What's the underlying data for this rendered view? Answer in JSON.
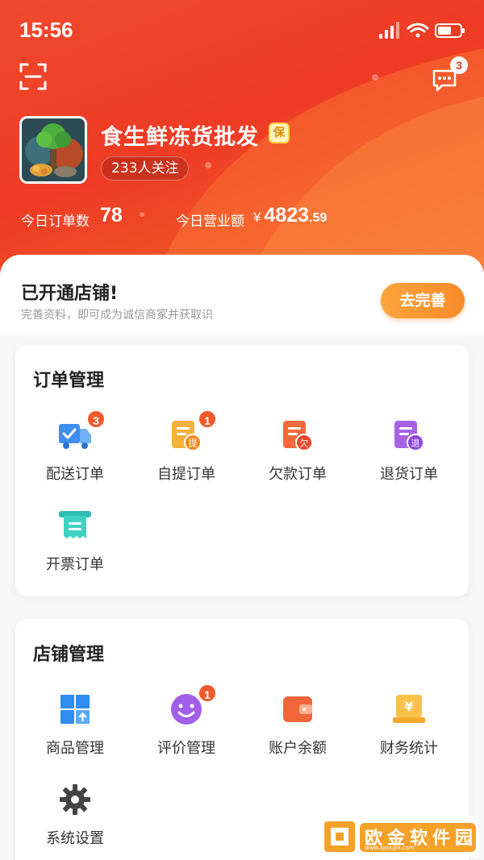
{
  "status_bar": {
    "time": "15:56"
  },
  "header": {
    "message_badge": "3",
    "shop_name": "食生鲜冻货批发",
    "shop_badge": "保",
    "followers": "233人关注",
    "stats": {
      "orders_label": "今日订单数",
      "orders_value": "78",
      "revenue_label": "今日营业额",
      "revenue_currency": "¥",
      "revenue_int": "4823",
      "revenue_dec": ".59"
    }
  },
  "promo": {
    "title": "已开通店铺!",
    "subtitle": "完善资料，即可成为诚信商家并获取识",
    "button": "去完善"
  },
  "order_management": {
    "title": "订单管理",
    "items": [
      {
        "label": "配送订单",
        "icon": "delivery-truck-icon",
        "badge": "3"
      },
      {
        "label": "自提订单",
        "icon": "pickup-order-icon",
        "badge": "1"
      },
      {
        "label": "欠款订单",
        "icon": "debt-order-icon",
        "badge": ""
      },
      {
        "label": "退货订单",
        "icon": "return-order-icon",
        "badge": ""
      },
      {
        "label": "开票订单",
        "icon": "invoice-icon",
        "badge": ""
      }
    ],
    "icon_text": {
      "pickup": "提",
      "debt": "欠",
      "return": "退"
    }
  },
  "store_management": {
    "title": "店铺管理",
    "items": [
      {
        "label": "商品管理",
        "icon": "product-grid-icon",
        "badge": ""
      },
      {
        "label": "评价管理",
        "icon": "smile-review-icon",
        "badge": "1"
      },
      {
        "label": "账户余额",
        "icon": "wallet-icon",
        "badge": ""
      },
      {
        "label": "财务统计",
        "icon": "finance-icon",
        "badge": ""
      },
      {
        "label": "系统设置",
        "icon": "gear-icon",
        "badge": ""
      }
    ],
    "icon_text": {
      "finance": "¥"
    }
  },
  "colors": {
    "brand_red": "#ee3b24",
    "accent_orange": "#f98a2a",
    "badge": "#f05a2a"
  },
  "watermark": {
    "name": "欧金软件园",
    "url": "www.apoujin.com"
  }
}
